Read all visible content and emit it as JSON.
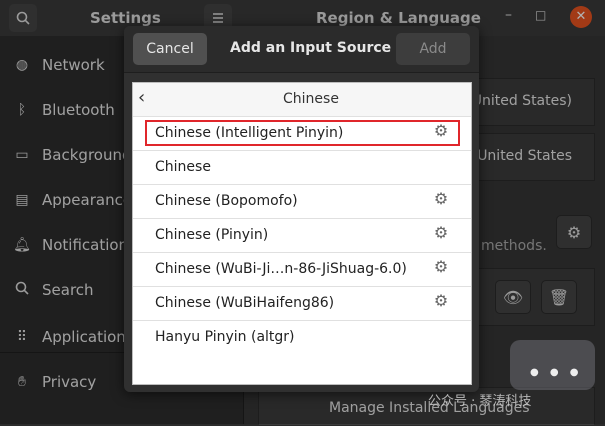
{
  "window": {
    "sidebar_title": "Settings",
    "panel_title": "Region & Language"
  },
  "sidebar": {
    "items": [
      {
        "label": "Network"
      },
      {
        "label": "Bluetooth"
      },
      {
        "label": "Background"
      },
      {
        "label": "Appearance"
      },
      {
        "label": "Notification"
      },
      {
        "label": "Search"
      },
      {
        "label": "Applications"
      },
      {
        "label": "Privacy"
      }
    ]
  },
  "region": {
    "language_value": "United States)",
    "formats_value": "United States",
    "input_hint": "methods.",
    "manage_label": "Manage Installed Languages"
  },
  "dialog": {
    "cancel_label": "Cancel",
    "title": "Add an Input Source",
    "add_label": "Add",
    "language": "Chinese",
    "sources": [
      {
        "label": "Chinese (Intelligent Pinyin)",
        "has_settings": true,
        "highlighted": true
      },
      {
        "label": "Chinese",
        "has_settings": false
      },
      {
        "label": "Chinese (Bopomofo)",
        "has_settings": true
      },
      {
        "label": "Chinese (Pinyin)",
        "has_settings": true
      },
      {
        "label": "Chinese (WuBi-Ji…n-86-JiShuag-6.0)",
        "has_settings": true
      },
      {
        "label": "Chinese (WuBiHaifeng86)",
        "has_settings": true
      },
      {
        "label": "Hanyu Pinyin (altgr)",
        "has_settings": false
      }
    ]
  },
  "watermark": {
    "text": "公众号 · 琴涛科技"
  },
  "colors": {
    "accent": "#e95420",
    "highlight": "#e0262b"
  }
}
